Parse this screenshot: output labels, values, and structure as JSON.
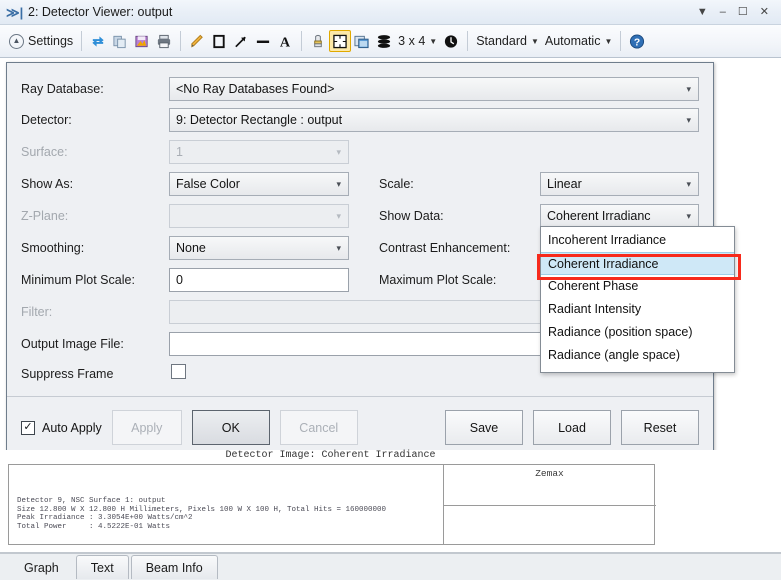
{
  "window": {
    "title": "2: Detector Viewer: output",
    "icon": "window-icon",
    "controls": [
      {
        "name": "menu-caret",
        "glyph": "▼"
      },
      {
        "name": "minimize",
        "glyph": "–"
      },
      {
        "name": "maximize",
        "glyph": "☐"
      },
      {
        "name": "close",
        "glyph": "✕"
      }
    ]
  },
  "toolbar": {
    "settings_label": "Settings",
    "grid_label": "3 x 4",
    "style_label": "Standard",
    "scale_label": "Automatic",
    "icons": [
      "refresh-icon",
      "copy-icon",
      "save-image-icon",
      "print-icon",
      "pencil-icon",
      "rectangle-icon",
      "arrow-icon",
      "line-icon",
      "text-icon",
      "eraser-icon",
      "fit-window-icon",
      "window-copy-icon",
      "layers-icon",
      "clock-icon",
      "help-icon"
    ]
  },
  "dialog": {
    "fields": {
      "ray_database": {
        "label": "Ray Database:",
        "value": "<No Ray Databases Found>"
      },
      "detector": {
        "label": "Detector:",
        "value": "9: Detector Rectangle : output"
      },
      "surface": {
        "label": "Surface:",
        "value": "1",
        "disabled": true
      },
      "show_as": {
        "label": "Show As:",
        "value": "False Color"
      },
      "z_plane": {
        "label": "Z-Plane:",
        "value": "",
        "disabled": true
      },
      "smoothing": {
        "label": "Smoothing:",
        "value": "None"
      },
      "minimum_plot_scale": {
        "label": "Minimum Plot Scale:",
        "value": "0"
      },
      "filter": {
        "label": "Filter:",
        "value": "",
        "disabled": true
      },
      "output_image_file": {
        "label": "Output Image File:",
        "value": ""
      },
      "suppress_frame": {
        "label": "Suppress Frame",
        "checked": false
      },
      "scale": {
        "label": "Scale:",
        "value": "Linear"
      },
      "show_data": {
        "label": "Show Data:",
        "value": "Coherent Irradianc"
      },
      "contrast_enhancement": {
        "label": "Contrast Enhancement:",
        "value": ""
      },
      "maximum_plot_scale": {
        "label": "Maximum Plot Scale:",
        "value": ""
      }
    },
    "show_data_options": [
      "Incoherent Irradiance",
      "Coherent Irradiance",
      "Coherent Phase",
      "Radiant Intensity",
      "Radiance (position space)",
      "Radiance (angle space)"
    ],
    "show_data_selected": "Coherent Irradiance",
    "highlight_color": "#f72a1c",
    "buttons": {
      "auto_apply": "Auto Apply",
      "auto_apply_checked": true,
      "apply": "Apply",
      "ok": "OK",
      "cancel": "Cancel",
      "save": "Save",
      "load": "Load",
      "reset": "Reset"
    }
  },
  "graph": {
    "header": "Detector Image: Coherent Irradiance",
    "brand": "Zemax",
    "text_lines": "Detector 9, NSC Surface 1: output\nSize 12.800 W X 12.800 H Millimeters, Pixels 100 W X 100 H, Total Hits = 160000000\nPeak Irradiance : 3.3054E+00 Watts/cm^2\nTotal Power     : 4.5222E-01 Watts"
  },
  "tabs": [
    {
      "label": "Graph",
      "active": true
    },
    {
      "label": "Text",
      "active": false
    },
    {
      "label": "Beam Info",
      "active": false
    }
  ]
}
